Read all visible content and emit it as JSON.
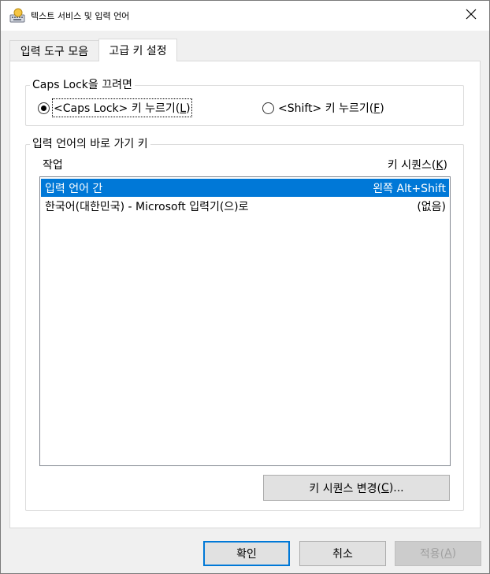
{
  "window": {
    "title": "텍스트 서비스 및 입력 언어",
    "close_icon": "close-icon"
  },
  "tabs": [
    {
      "label": "입력 도구 모음",
      "selected": false
    },
    {
      "label": "고급 키 설정",
      "selected": true
    }
  ],
  "caps_lock": {
    "group_label": "Caps Lock을 끄려면",
    "options": [
      {
        "prefix": "<Caps Lock> 키 누르기(",
        "mnemonic": "L",
        "suffix": ")",
        "checked": true
      },
      {
        "prefix": "<Shift> 키 누르기(",
        "mnemonic": "F",
        "suffix": ")",
        "checked": false
      }
    ]
  },
  "hotkeys": {
    "group_label": "입력 언어의 바로 가기 키",
    "col_action": "작업",
    "col_sequence_prefix": "키 시퀀스(",
    "col_sequence_mnemonic": "K",
    "col_sequence_suffix": ")",
    "rows": [
      {
        "action": "입력 언어 간",
        "sequence": "왼쪽 Alt+Shift",
        "selected": true
      },
      {
        "action": "한국어(대한민국) - Microsoft 입력기(으)로",
        "sequence": "(없음)",
        "selected": false
      }
    ],
    "change_button": {
      "prefix": "키 시퀀스 변경(",
      "mnemonic": "C",
      "suffix": ")..."
    }
  },
  "footer": {
    "ok": "확인",
    "cancel": "취소",
    "apply_prefix": "적용(",
    "apply_mnemonic": "A",
    "apply_suffix": ")"
  },
  "colors": {
    "selection": "#0078d7",
    "default_button_border": "#0078d7"
  }
}
